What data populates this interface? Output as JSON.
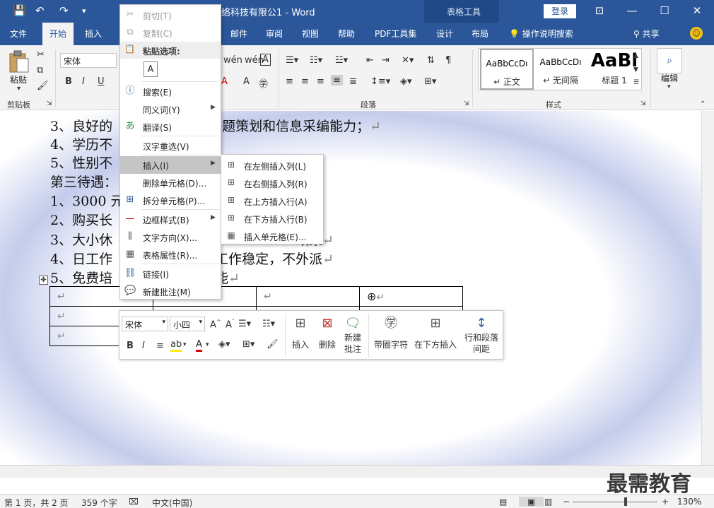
{
  "titlebar": {
    "doc_title": "网络科技有限公1 - Word",
    "context_tab_group": "表格工具",
    "login": "登录"
  },
  "tabs": [
    "文件",
    "开始",
    "插入",
    "邮件",
    "审阅",
    "视图",
    "帮助",
    "PDF工具集",
    "设计",
    "布局"
  ],
  "tell_me": "操作说明搜索",
  "share": "共享",
  "ribbon": {
    "paste_label": "粘贴",
    "clipboard_label": "剪贴板",
    "font_name": "宋体",
    "paragraph_label": "段落",
    "styles_label": "样式",
    "editing_label": "编辑",
    "styles": [
      {
        "sample": "AaBbCcDı",
        "name": "↵ 正文"
      },
      {
        "sample": "AaBbCcDı",
        "name": "↵ 无间隔"
      },
      {
        "sample": "AaBl",
        "name": "标题 1"
      }
    ]
  },
  "document": {
    "lines": [
      "3、良好的",
      "4、学历不",
      "5、性别不",
      "第三待遇：",
      "1、3000 元",
      "2、购买长",
      "3、大小休",
      "4、日工作",
      "5、免费培"
    ],
    "line_tails": [
      "强的网站专题策划和信息采编能力；",
      "",
      "",
      "",
      "",
      "",
      "政策",
      "工作稳定，不外派",
      "网技能"
    ],
    "paragraph_mark": "↵"
  },
  "context_menu": {
    "cut": "剪切(T)",
    "copy": "复制(C)",
    "paste_options": "粘贴选项:",
    "search": "搜索(E)",
    "synonyms": "同义词(Y)",
    "translate": "翻译(S)",
    "reconvert": "汉字重选(V)",
    "insert": "插入(I)",
    "delete_cells": "删除单元格(D)...",
    "split_cells": "拆分单元格(P)...",
    "border_styles": "边框样式(B)",
    "text_direction": "文字方向(X)...",
    "table_properties": "表格属性(R)...",
    "link": "链接(I)",
    "new_comment": "新建批注(M)"
  },
  "insert_submenu": [
    "在左侧插入列(L)",
    "在右侧插入列(R)",
    "在上方插入行(A)",
    "在下方插入行(B)",
    "插入单元格(E)..."
  ],
  "mini_toolbar": {
    "font_name": "宋体",
    "font_size": "小四",
    "insert": "插入",
    "delete": "删除",
    "new_comment_1": "新建",
    "new_comment_2": "批注",
    "enclosed_chars": "带圈字符",
    "insert_below": "在下方插入",
    "spacing_1": "行和段落",
    "spacing_2": "间距"
  },
  "statusbar": {
    "page": "第 1 页，共 2 页",
    "words": "359 个字",
    "language": "中文(中国)",
    "zoom": "130%"
  },
  "watermark": "最需教育",
  "colors": {
    "brand": "#2b579a",
    "font_color_bar": "#e00000",
    "highlight_bar": "#ffee00"
  }
}
